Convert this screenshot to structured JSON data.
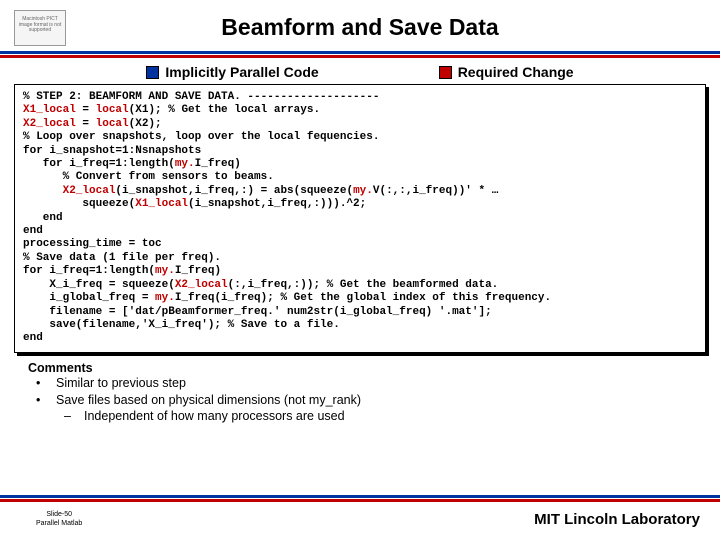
{
  "title": "Beamform and Save Data",
  "placeholder": "Macintosh PICT image format is not supported",
  "legend": {
    "left": "Implicitly Parallel Code",
    "right": "Required Change"
  },
  "code": {
    "l1": "% STEP 2: BEAMFORM AND SAVE DATA. --------------------",
    "l2a": "X1_local",
    "l2b": " = ",
    "l2c": "local",
    "l2d": "(X1); % Get the local arrays.",
    "l3a": "X2_local",
    "l3b": " = ",
    "l3c": "local",
    "l3d": "(X2);",
    "l4": "% Loop over snapshots, loop over the local fequencies.",
    "l5": "for i_snapshot=1:Nsnapshots",
    "l6a": "   for i_freq=1:length(",
    "l6b": "my.",
    "l6c": "I_freq)",
    "l7": "      % Convert from sensors to beams.",
    "l8a": "      ",
    "l8b": "X2_local",
    "l8c": "(i_snapshot,i_freq,:) = abs(squeeze(",
    "l8d": "my.",
    "l8e": "V(:,:,i_freq))' * …",
    "l9a": "         squeeze(",
    "l9b": "X1_local",
    "l9c": "(i_snapshot,i_freq,:))).^2;",
    "l10": "   end",
    "l11": "end",
    "l12": "processing_time = toc",
    "l13": "% Save data (1 file per freq).",
    "l14a": "for i_freq=1:length(",
    "l14b": "my.",
    "l14c": "I_freq)",
    "l15a": "    X_i_freq = squeeze(",
    "l15b": "X2_local",
    "l15c": "(:,i_freq,:)); % Get the beamformed data.",
    "l16a": "    i_global_freq = ",
    "l16b": "my.",
    "l16c": "I_freq(i_freq); % Get the global index of this frequency.",
    "l17": "    filename = ['dat/pBeamformer_freq.' num2str(i_global_freq) '.mat'];",
    "l18": "    save(filename,'X_i_freq'); % Save to a file.",
    "l19": "end"
  },
  "comments": {
    "head": "Comments",
    "b1": "Similar to previous step",
    "b2": "Save files based on physical dimensions (not my_rank)",
    "b2a": "Independent of how many processors are used"
  },
  "footer": {
    "slide": "Slide-50",
    "sub": "Parallel Matlab",
    "mit": "MIT Lincoln Laboratory"
  }
}
